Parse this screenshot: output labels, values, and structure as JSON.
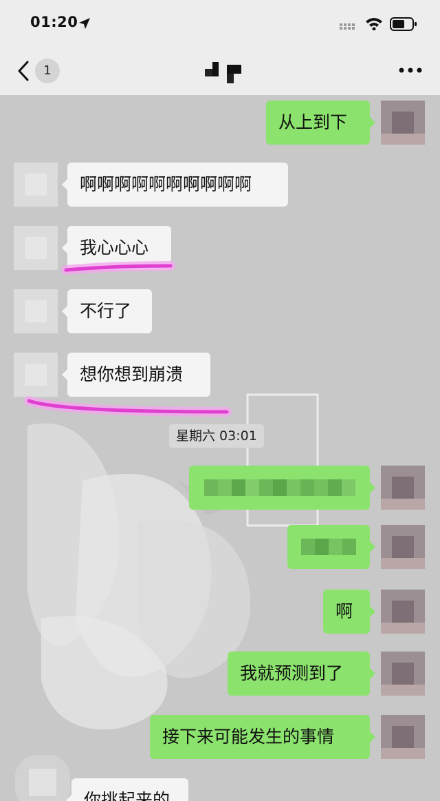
{
  "status_bar": {
    "time": "01:20"
  },
  "nav": {
    "unread_count": "1"
  },
  "messages": [
    {
      "side": "out",
      "text": "从上到下"
    },
    {
      "side": "in",
      "text": "啊啊啊啊啊啊啊啊啊啊"
    },
    {
      "side": "in",
      "text": "我心心心"
    },
    {
      "side": "in",
      "text": "不行了"
    },
    {
      "side": "in",
      "text": "想你想到崩溃"
    },
    {
      "side": "out",
      "text": ""
    },
    {
      "side": "out",
      "text": ""
    },
    {
      "side": "out",
      "text": "啊"
    },
    {
      "side": "out",
      "text": "我就预测到了"
    },
    {
      "side": "out",
      "text": "接下来可能发生的事情"
    },
    {
      "side": "in",
      "text": "你挑起来的"
    }
  ],
  "timestamp": "星期六 03:01",
  "colors": {
    "outgoing_bubble": "#8be26d",
    "incoming_bubble": "#f4f4f4",
    "highlight": "#e040d0"
  }
}
